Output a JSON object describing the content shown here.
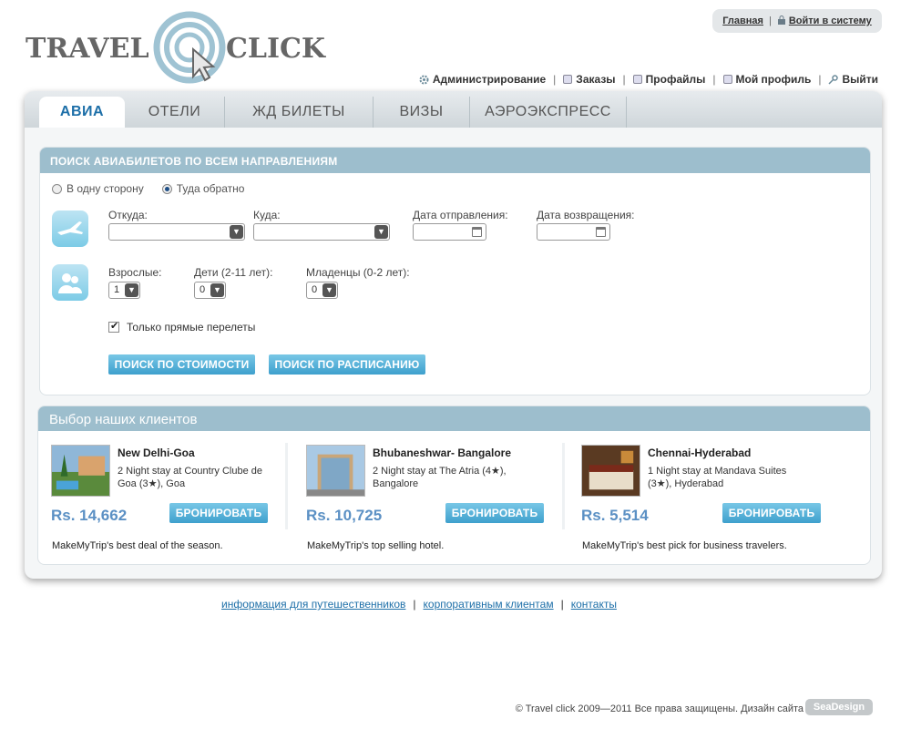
{
  "brand": {
    "word1": "TRAVEL",
    "word2": "CLICK"
  },
  "top_links": {
    "home": "Главная",
    "login": "Войти в систему"
  },
  "admin_menu": [
    {
      "label": "Администрирование",
      "icon": "gear-icon"
    },
    {
      "label": "Заказы",
      "icon": "orders-icon"
    },
    {
      "label": "Профайлы",
      "icon": "profiles-icon"
    },
    {
      "label": "Мой профиль",
      "icon": "profile-icon"
    },
    {
      "label": "Выйти",
      "icon": "key-icon"
    }
  ],
  "tabs": [
    {
      "label": "АВИА",
      "active": true
    },
    {
      "label": "ОТЕЛИ"
    },
    {
      "label": "ЖД БИЛЕТЫ"
    },
    {
      "label": "ВИЗЫ"
    },
    {
      "label": "АЭРОЭКСПРЕСС"
    }
  ],
  "search": {
    "heading": "ПОИСК АВИАБИЛЕТОВ ПО ВСЕМ НАПРАВЛЕНИЯМ",
    "trip_oneway": "В одну сторону",
    "trip_roundtrip": "Туда обратно",
    "selected_trip": "roundtrip",
    "from_label": "Откуда:",
    "to_label": "Куда:",
    "depart_label": "Дата отправления:",
    "return_label": "Дата возвращения:",
    "adults_label": "Взрослые:",
    "children_label": "Дети (2-11 лет):",
    "infants_label": "Младенцы (0-2 лет):",
    "adults_value": "1",
    "children_value": "0",
    "infants_value": "0",
    "direct_only_label": "Только прямые перелеты",
    "direct_only_checked": true,
    "btn_price": "ПОИСК ПО СТОИМОСТИ",
    "btn_schedule": "ПОИСК ПО РАСПИСАНИЮ"
  },
  "clients": {
    "heading": "Выбор наших клиентов",
    "book_label": "БРОНИРОВАТЬ",
    "deals": [
      {
        "title": "New Delhi-Goa",
        "desc": "2 Night stay at Country Clube de Goa (3★), Goa",
        "price": "Rs. 14,662",
        "note": "MakeMyTrip's best deal of the season."
      },
      {
        "title": "Bhubaneshwar- Bangalore",
        "desc": "2 Night stay at The Atria (4★), Bangalore",
        "price": "Rs. 10,725",
        "note": "MakeMyTrip's top selling hotel."
      },
      {
        "title": "Chennai-Hyderabad",
        "desc": "1 Night stay at Mandava Suites (3★), Hyderabad",
        "price": "Rs. 5,514",
        "note": "MakeMyTrip's best pick for business travelers."
      }
    ]
  },
  "footer": {
    "links": [
      "информация для путешественников",
      "корпоративным клиентам",
      "контакты"
    ],
    "copyright": "© Travel click  2009—2011  Все права защищены.   Дизайн сайта",
    "designer": "SeaDesign"
  },
  "colors": {
    "accent": "#1d6fa8",
    "header_bar": "#9dbecd",
    "button": "#3ea0cd",
    "price": "#5b90c4"
  }
}
